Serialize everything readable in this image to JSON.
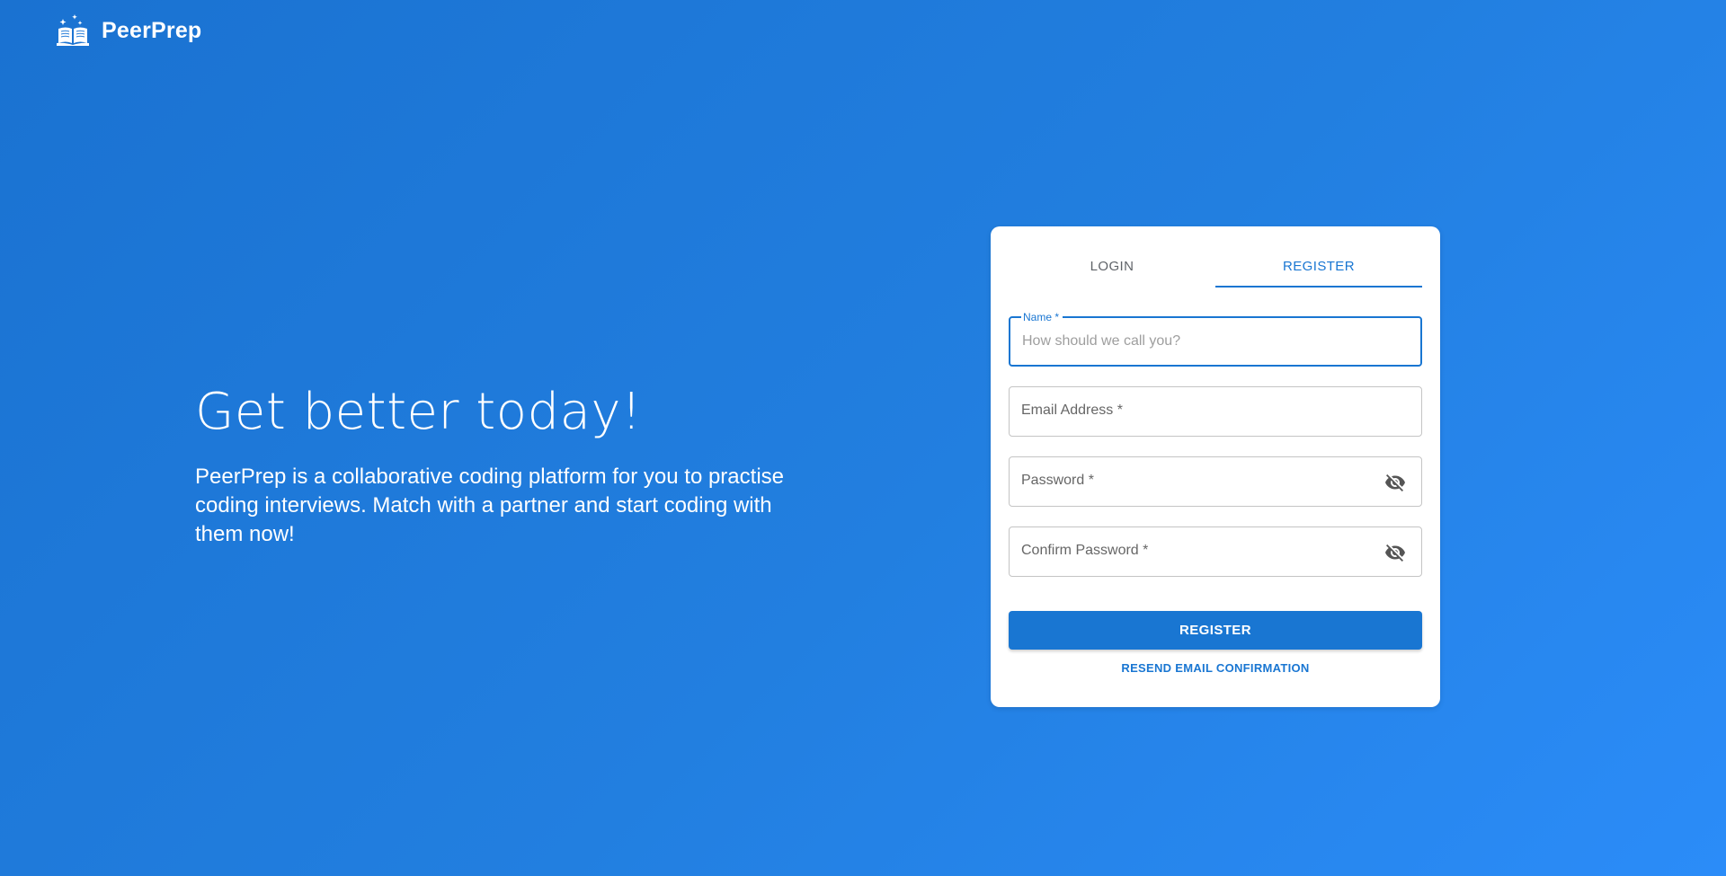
{
  "brand": {
    "logo_icon": "open-book-sparkle-icon",
    "name": "PeerPrep"
  },
  "hero": {
    "title": "Get better today!",
    "description": "PeerPrep is a collaborative coding platform for you to practise coding interviews. Match with a partner and start coding with them now!"
  },
  "auth": {
    "tabs": [
      {
        "label": "LOGIN",
        "active": false
      },
      {
        "label": "REGISTER",
        "active": true
      }
    ],
    "fields": {
      "name": {
        "label": "Name *",
        "placeholder": "How should we call you?",
        "value": "",
        "focused": true
      },
      "email": {
        "label": "Email Address *",
        "value": ""
      },
      "password": {
        "label": "Password *",
        "value": "",
        "toggle_icon": "eye-off-icon"
      },
      "confirm_password": {
        "label": "Confirm Password *",
        "value": "",
        "toggle_icon": "eye-off-icon"
      }
    },
    "register_button": "REGISTER",
    "resend_link": "RESEND EMAIL CONFIRMATION"
  },
  "colors": {
    "primary": "#1976d2",
    "background_start": "#1a72d1",
    "background_end": "#2b8cf8"
  }
}
